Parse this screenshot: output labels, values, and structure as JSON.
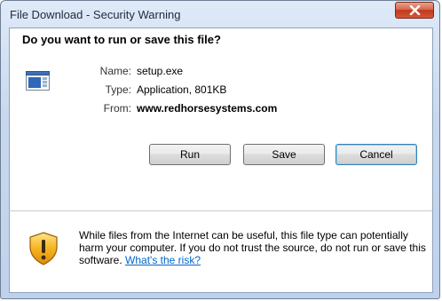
{
  "window": {
    "title": "File Download - Security Warning",
    "close_glyph": "X"
  },
  "dialog": {
    "question": "Do you want to run or save this file?",
    "file_icon": "executable-file-icon",
    "details": {
      "name_label": "Name:",
      "name_value": "setup.exe",
      "type_label": "Type:",
      "type_value": "Application, 801KB",
      "from_label": "From:",
      "from_value": "www.redhorsesystems.com"
    },
    "buttons": {
      "run": "Run",
      "save": "Save",
      "cancel": "Cancel"
    }
  },
  "warning": {
    "icon": "security-shield-icon",
    "text": "While files from the Internet can be useful, this file type can potentially harm your computer. If you do not trust the source, do not run or save this software. ",
    "link": "What's the risk?",
    "link_color": "#0066cc"
  },
  "colors": {
    "frame": "#c7d8ee",
    "close_button": "#c2391a",
    "default_button_border": "#3c7fb1"
  }
}
